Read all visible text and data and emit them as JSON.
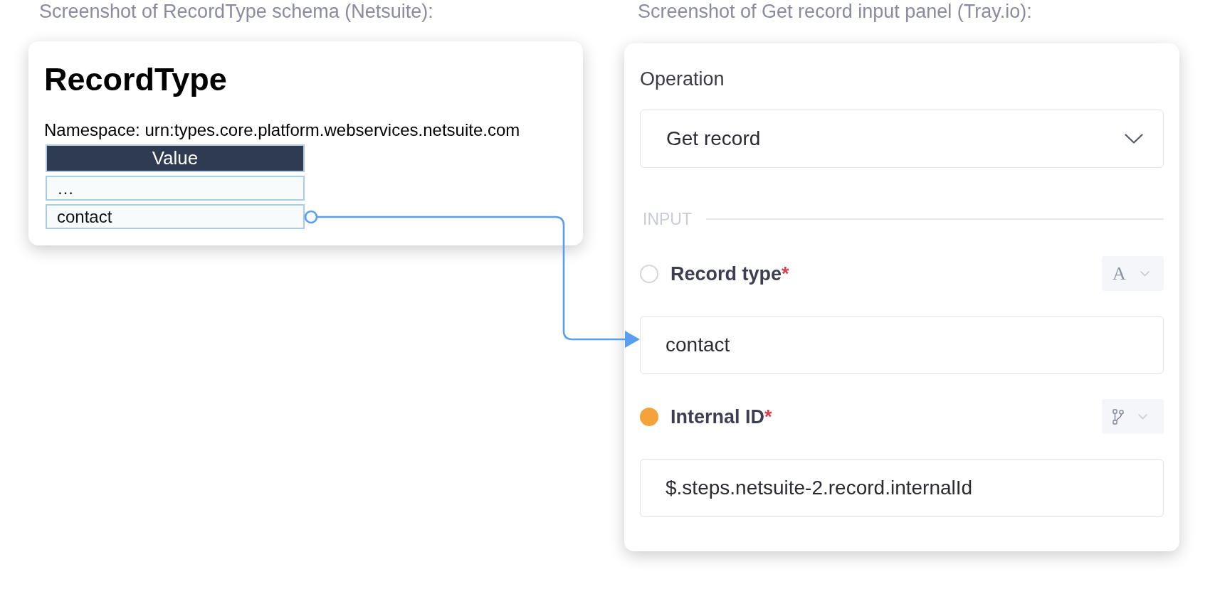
{
  "schema_panel": {
    "caption": "Screenshot of RecordType schema (Netsuite):",
    "title": "RecordType",
    "namespace": "Namespace: urn:types.core.platform.webservices.netsuite.com",
    "table": {
      "columns": [
        "Value"
      ],
      "rows": [
        [
          "…"
        ],
        [
          "contact"
        ]
      ]
    }
  },
  "input_panel": {
    "caption": "Screenshot of Get record input panel (Tray.io):",
    "operation": {
      "label": "Operation",
      "value": "Get record"
    },
    "section_label": "INPUT",
    "fields": [
      {
        "kind": "text",
        "label": "Record type",
        "required_mark": "*",
        "mapped": false,
        "type_glyph": "A",
        "value": "contact"
      },
      {
        "kind": "jsonpath",
        "label": "Internal ID",
        "required_mark": "*",
        "mapped": true,
        "value": "$.steps.netsuite-2.record.internalId"
      }
    ]
  }
}
